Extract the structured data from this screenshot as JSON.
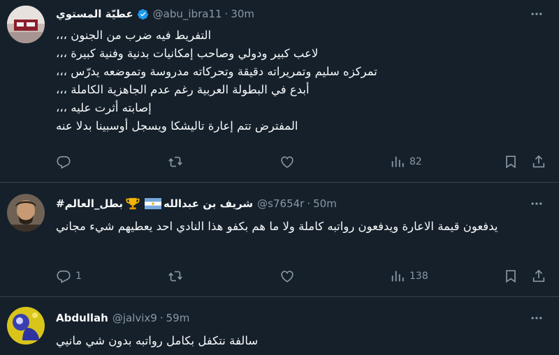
{
  "tweets": [
    {
      "name": "عطيّة المستوي",
      "handle": "@abu_ibra11",
      "dot": "·",
      "time": "30m",
      "text": "التفريط فيه ضرب من الجنون ،،،\nلاعب كبير ودولي وصاحب إمكانيات بدنية وفنية كبيرة ،،،\nتمركزه سليم وتمريراته دقيقة وتحركاته مدروسة وتموضعه يدرّس ،،،\nأبدع في البطولة العربية رغم عدم الجاهزية الكاملة ،،،\nإصابته أثرت عليه ،،،\nالمفترض تتم إعارة تاليشكا ويسجل أوسبينا بدلا عنه",
      "replies": "",
      "views": "82"
    },
    {
      "name_part1": "شريف بن عبدالله",
      "name_part2": "#بطل_العالم",
      "handle": "@s7654r",
      "dot": "·",
      "time": "50m",
      "text": "يدفعون قيمة الاعارة ويدفعون رواتبه كاملة ولا ما هم بكفو هذا النادي احد يعطيهم شيء مجاني",
      "replies": "1",
      "views": "138"
    },
    {
      "name": "Abdullah",
      "handle": "@jalvix9",
      "dot": "·",
      "time": "59m",
      "text": "سالفة نتكفل بكامل رواتبه بدون شي مانيي"
    }
  ],
  "colors": {
    "background": "#15202b",
    "text": "#f7f9f9",
    "muted": "#8b98a5",
    "border": "#38444d",
    "verified": "#1d9bf0"
  },
  "icons": [
    "more-icon",
    "reply-icon",
    "retweet-icon",
    "like-icon",
    "views-icon",
    "bookmark-icon",
    "share-icon",
    "verified-badge-icon",
    "argentina-flag-icon",
    "trophy-icon"
  ]
}
